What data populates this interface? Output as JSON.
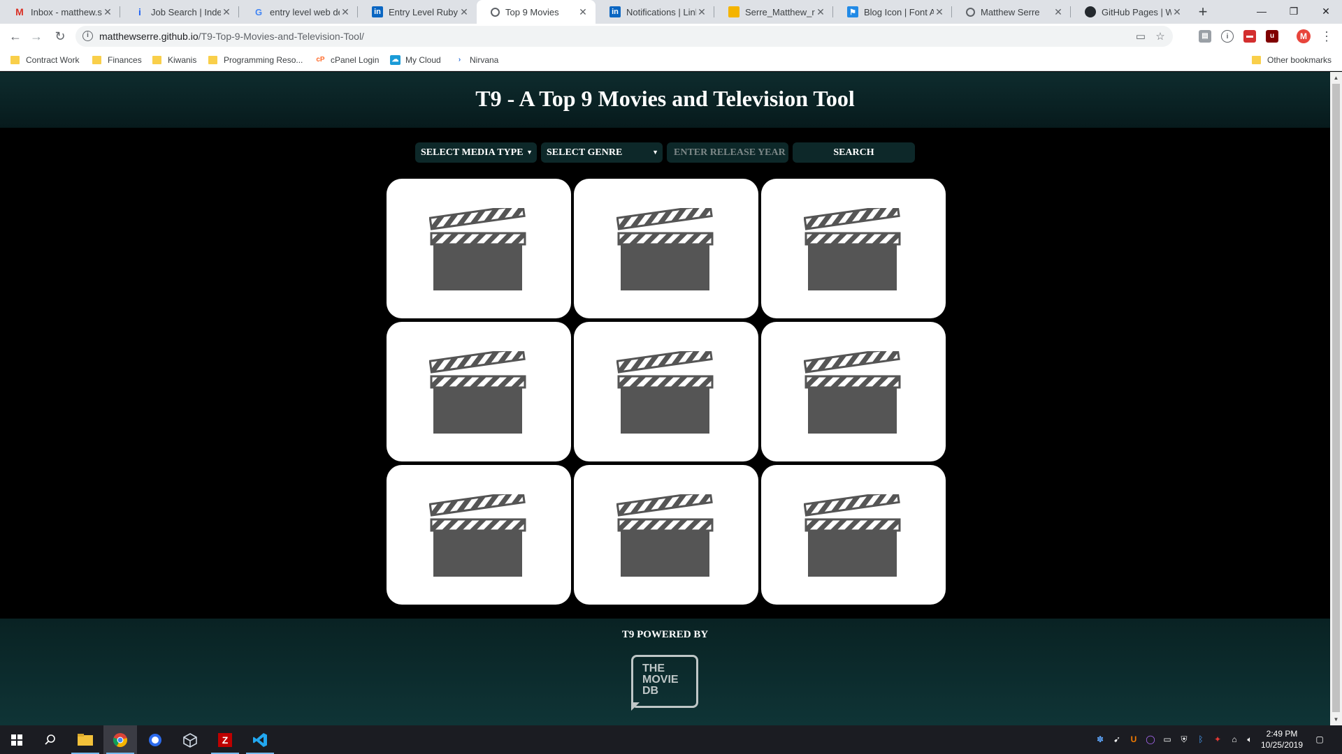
{
  "browser": {
    "tabs": [
      {
        "title": "Inbox - matthew.serre",
        "icon": "gmail-icon",
        "active": false
      },
      {
        "title": "Job Search | Indeed",
        "icon": "indeed-icon",
        "active": false
      },
      {
        "title": "entry level web developer",
        "icon": "google-icon",
        "active": false
      },
      {
        "title": "Entry Level Ruby on Rails",
        "icon": "linkedin-icon",
        "active": false
      },
      {
        "title": "Top 9 Movies",
        "icon": "globe-icon",
        "active": true
      },
      {
        "title": "Notifications | LinkedIn",
        "icon": "linkedin-icon",
        "active": false
      },
      {
        "title": "Serre_Matthew_resume",
        "icon": "slides-icon",
        "active": false
      },
      {
        "title": "Blog Icon | Font Awesome",
        "icon": "fontawesome-icon",
        "active": false
      },
      {
        "title": "Matthew Serre",
        "icon": "globe-icon",
        "active": false
      },
      {
        "title": "GitHub Pages | Websites",
        "icon": "github-icon",
        "active": false
      }
    ],
    "url_host": "matthewserre.github.io",
    "url_path": "/T9-Top-9-Movies-and-Television-Tool/",
    "profile_initial": "M",
    "bookmarks": [
      {
        "label": "Contract Work",
        "type": "folder"
      },
      {
        "label": "Finances",
        "type": "folder"
      },
      {
        "label": "Kiwanis",
        "type": "folder"
      },
      {
        "label": "Programming Reso...",
        "type": "folder"
      },
      {
        "label": "cPanel Login",
        "type": "link"
      },
      {
        "label": "My Cloud",
        "type": "link"
      },
      {
        "label": "Nirvana",
        "type": "link"
      }
    ],
    "other_bookmarks": "Other bookmarks"
  },
  "site": {
    "title": "T9 - A Top 9 Movies and Television Tool",
    "media_type_select": "SELECT MEDIA TYPE",
    "genre_select": "SELECT GENRE",
    "year_placeholder": "ENTER RELEASE YEAR",
    "search_label": "SEARCH",
    "result_count": 9,
    "footer_text": "T9 POWERED BY",
    "tmdb_logo": [
      "THE",
      "MOVIE",
      "DB"
    ]
  },
  "colors": {
    "header_bg": "#0e2c2e",
    "control_bg": "#0d2829",
    "card_bg": "#ffffff",
    "clapper": "#555555"
  },
  "taskbar": {
    "time": "2:49 PM",
    "date": "10/25/2019"
  }
}
